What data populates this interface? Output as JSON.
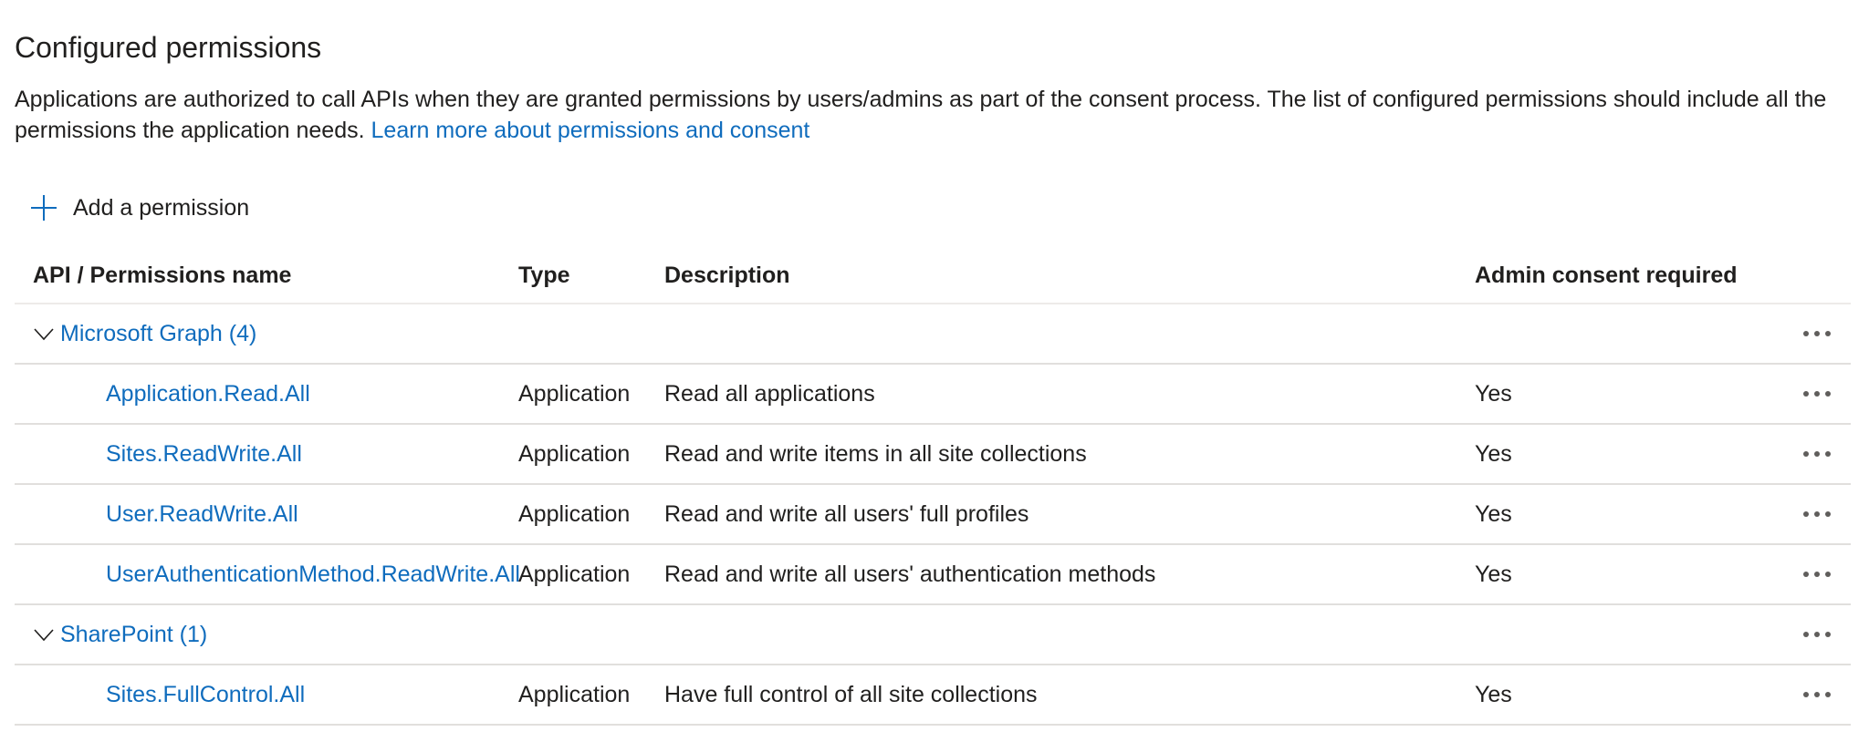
{
  "section": {
    "title": "Configured permissions",
    "description": "Applications are authorized to call APIs when they are granted permissions by users/admins as part of the consent process. The list of configured permissions should include all the permissions the application needs.",
    "learn_more_link": "Learn more about permissions and consent"
  },
  "toolbar": {
    "add_permission_label": "Add a permission",
    "add_icon": "plus-icon"
  },
  "table": {
    "columns": {
      "name": "API / Permissions name",
      "type": "Type",
      "description": "Description",
      "admin_consent": "Admin consent required"
    },
    "groups": [
      {
        "label": "Microsoft Graph (4)",
        "expanded": true,
        "permissions": [
          {
            "name": "Application.Read.All",
            "type": "Application",
            "description": "Read all applications",
            "admin_consent": "Yes"
          },
          {
            "name": "Sites.ReadWrite.All",
            "type": "Application",
            "description": "Read and write items in all site collections",
            "admin_consent": "Yes"
          },
          {
            "name": "User.ReadWrite.All",
            "type": "Application",
            "description": "Read and write all users' full profiles",
            "admin_consent": "Yes"
          },
          {
            "name": "UserAuthenticationMethod.ReadWrite.All",
            "type": "Application",
            "description": "Read and write all users' authentication methods",
            "admin_consent": "Yes"
          }
        ]
      },
      {
        "label": "SharePoint (1)",
        "expanded": true,
        "permissions": [
          {
            "name": "Sites.FullControl.All",
            "type": "Application",
            "description": "Have full control of all site collections",
            "admin_consent": "Yes"
          }
        ]
      }
    ]
  },
  "colors": {
    "link": "#0f6cbd",
    "text": "#201f1e",
    "divider": "#e1dfdd"
  },
  "icons": {
    "expand": "chevron-down-icon",
    "more": "more-options-icon"
  }
}
